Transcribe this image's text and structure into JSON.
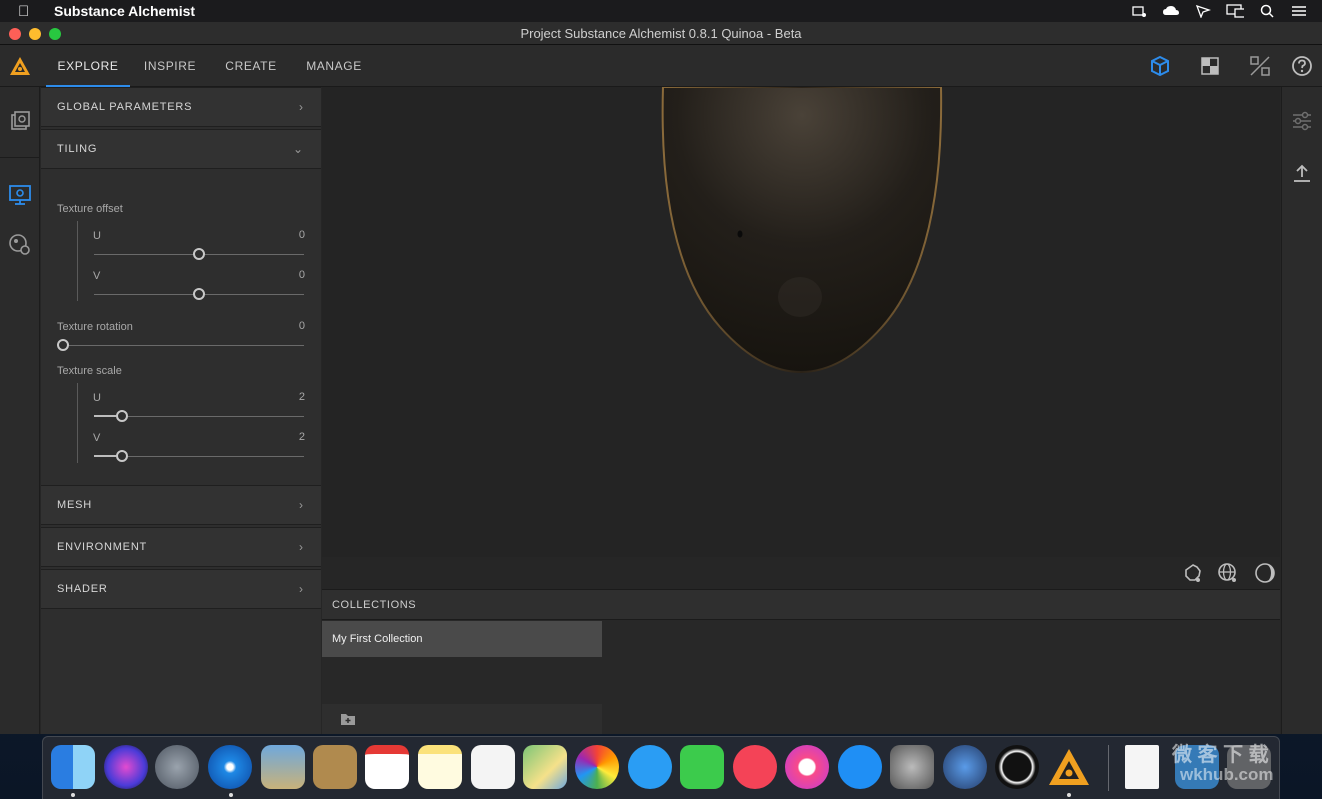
{
  "menubar": {
    "app_name": "Substance Alchemist",
    "status_icons": [
      "keychain-icon",
      "cloud-icon",
      "wifi-direct-icon",
      "screen-mirroring-icon",
      "search-icon",
      "control-center-icon"
    ]
  },
  "window": {
    "title": "Project Substance Alchemist 0.8.1 Quinoa - Beta"
  },
  "tabs": [
    {
      "label": "EXPLORE",
      "active": true
    },
    {
      "label": "INSPIRE",
      "active": false
    },
    {
      "label": "CREATE",
      "active": false
    },
    {
      "label": "MANAGE",
      "active": false
    }
  ],
  "panel": {
    "global_parameters": "GLOBAL PARAMETERS",
    "tiling": "TILING",
    "texture_offset": "Texture offset",
    "offset_u_label": "U",
    "offset_u_value": "0",
    "offset_v_label": "V",
    "offset_v_value": "0",
    "texture_rotation": "Texture rotation",
    "rotation_value": "0",
    "texture_scale": "Texture scale",
    "scale_u_label": "U",
    "scale_u_value": "2",
    "scale_v_label": "V",
    "scale_v_value": "2",
    "mesh": "MESH",
    "environment": "ENVIRONMENT",
    "shader": "SHADER"
  },
  "collections": {
    "header": "COLLECTIONS",
    "items": [
      "My First Collection"
    ]
  },
  "colors": {
    "accent": "#2d8ceb",
    "panel_bg": "#2e2e2e",
    "viewport_bg": "#242424"
  },
  "watermark": {
    "line1": "微 客 下 载",
    "line2": "wkhub.com"
  }
}
